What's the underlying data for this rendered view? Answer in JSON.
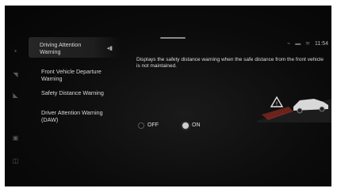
{
  "menu": {
    "items": [
      {
        "label": "Driving Attention Warning",
        "selected": true
      },
      {
        "label": "Front Vehicle Departure Warning",
        "selected": false
      },
      {
        "label": "Safety Distance Warning",
        "selected": false
      },
      {
        "label": "Driver Attention Warning (DAW)",
        "selected": false
      }
    ]
  },
  "detail": {
    "description": "Displays the safety distance warning when the safe distance from the front vehicle is not maintained."
  },
  "options": {
    "off_label": "OFF",
    "on_label": "ON",
    "selected": "ON"
  },
  "status_bar": {
    "clock": "11:54"
  },
  "colors": {
    "screen_bg": "#0b0b0b",
    "text": "#d9d9d9",
    "warning_red": "#c0392b"
  }
}
